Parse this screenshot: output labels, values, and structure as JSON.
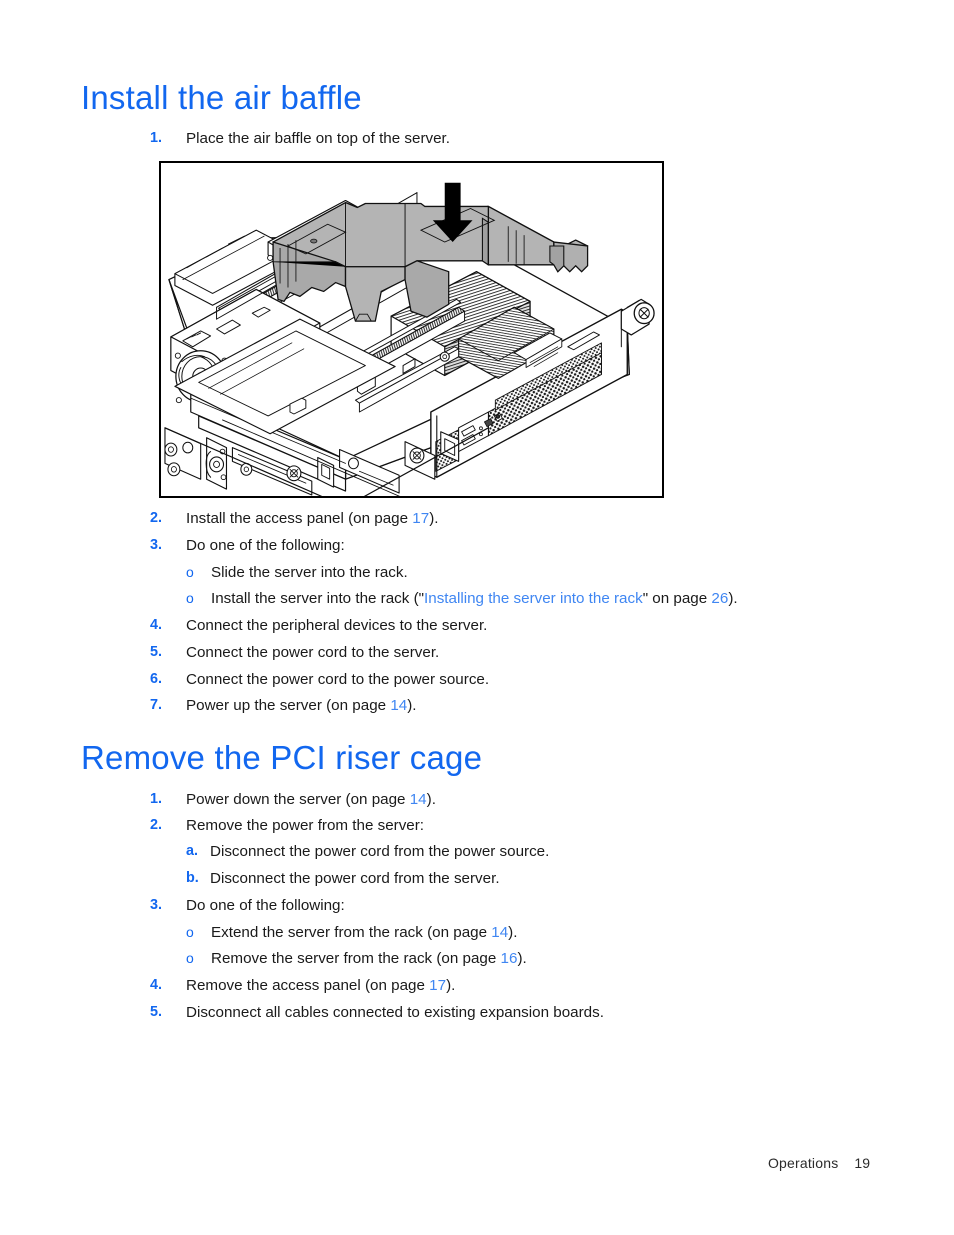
{
  "document": {
    "footer_label": "Operations",
    "footer_page": "19"
  },
  "colors": {
    "heading_blue": "#1267ef",
    "marker_blue": "#1267ef",
    "link_blue": "#3f86f2",
    "body_black": "#1a1a1a",
    "baffle_gray": "#b4b4b4",
    "frame_black": "#000000"
  },
  "sections": [
    {
      "id": "install-air-baffle",
      "heading": "Install the air baffle",
      "steps": [
        {
          "marker": "1.",
          "text": "Place the air baffle on top of the server."
        },
        {
          "marker": "2.",
          "pre": "Install the access panel (on page ",
          "link": "17",
          "post": ")."
        },
        {
          "marker": "3.",
          "text": "Do one of the following:"
        },
        {
          "marker": "o",
          "text": "Slide the server into the rack."
        },
        {
          "marker": "o",
          "pre": "Install the server into the rack (\"",
          "link": "Installing the server into the rack",
          "mid": "\" on page ",
          "link2": "26",
          "post": ")."
        },
        {
          "marker": "4.",
          "text": "Connect the peripheral devices to the server."
        },
        {
          "marker": "5.",
          "text": "Connect the power cord to the server."
        },
        {
          "marker": "6.",
          "text": "Connect the power cord to the power source."
        },
        {
          "marker": "7.",
          "pre": "Power up the server (on page ",
          "link": "14",
          "post": ")."
        }
      ]
    },
    {
      "id": "remove-pci-riser-cage",
      "heading": "Remove the PCI riser cage",
      "steps": [
        {
          "marker": "1.",
          "pre": "Power down the server (on page ",
          "link": "14",
          "post": ")."
        },
        {
          "marker": "2.",
          "text": "Remove the power from the server:"
        },
        {
          "marker": "a.",
          "text": "Disconnect the power cord from the power source."
        },
        {
          "marker": "b.",
          "text": "Disconnect the power cord from the server."
        },
        {
          "marker": "3.",
          "text": "Do one of the following:"
        },
        {
          "marker": "o",
          "pre": "Extend the server from the rack (on page ",
          "link": "14",
          "post": ")."
        },
        {
          "marker": "o",
          "pre": "Remove the server from the rack (on page ",
          "link": "16",
          "post": ")."
        },
        {
          "marker": "4.",
          "pre": "Remove the access panel (on page ",
          "link": "17",
          "post": ")."
        },
        {
          "marker": "5.",
          "text": "Disconnect all cables connected to existing expansion boards."
        }
      ]
    }
  ],
  "figure": {
    "name": "air-baffle-installation-diagram",
    "description": "Line-art illustration of a 1U rack server with its access panel removed, showing a gray plastic air baffle being lowered onto the system board over the processor heatsink. A heavy black downward arrow indicates the installation direction.",
    "callouts": []
  },
  "steps_flat": {
    "s1_1": "Place the air baffle on top of the server.",
    "s1_2_pre": "Install the access panel (on page ",
    "s1_2_link": "17",
    "s1_2_post": ").",
    "s1_3": "Do one of the following:",
    "s1_3a": "Slide the server into the rack.",
    "s1_3b_pre": "Install the server into the rack (\"",
    "s1_3b_link": "Installing the server into the rack",
    "s1_3b_mid": "\" on page ",
    "s1_3b_link2": "26",
    "s1_3b_post": ").",
    "s1_4": "Connect the peripheral devices to the server.",
    "s1_5": "Connect the power cord to the server.",
    "s1_6": "Connect the power cord to the power source.",
    "s1_7_pre": "Power up the server (on page ",
    "s1_7_link": "14",
    "s1_7_post": ").",
    "s2_1_pre": "Power down the server (on page ",
    "s2_1_link": "14",
    "s2_1_post": ").",
    "s2_2": "Remove the power from the server:",
    "s2_2a": "Disconnect the power cord from the power source.",
    "s2_2b": "Disconnect the power cord from the server.",
    "s2_3": "Do one of the following:",
    "s2_3a_pre": "Extend the server from the rack (on page ",
    "s2_3a_link": "14",
    "s2_3a_post": ").",
    "s2_3b_pre": "Remove the server from the rack (on page ",
    "s2_3b_link": "16",
    "s2_3b_post": ").",
    "s2_4_pre": "Remove the access panel (on page ",
    "s2_4_link": "17",
    "s2_4_post": ").",
    "s2_5": "Disconnect all cables connected to existing expansion boards."
  },
  "markers": {
    "m1": "1.",
    "m2": "2.",
    "m3": "3.",
    "m4": "4.",
    "m5": "5.",
    "m6": "6.",
    "m7": "7.",
    "ma": "a.",
    "mb": "b.",
    "bullet": "o"
  }
}
